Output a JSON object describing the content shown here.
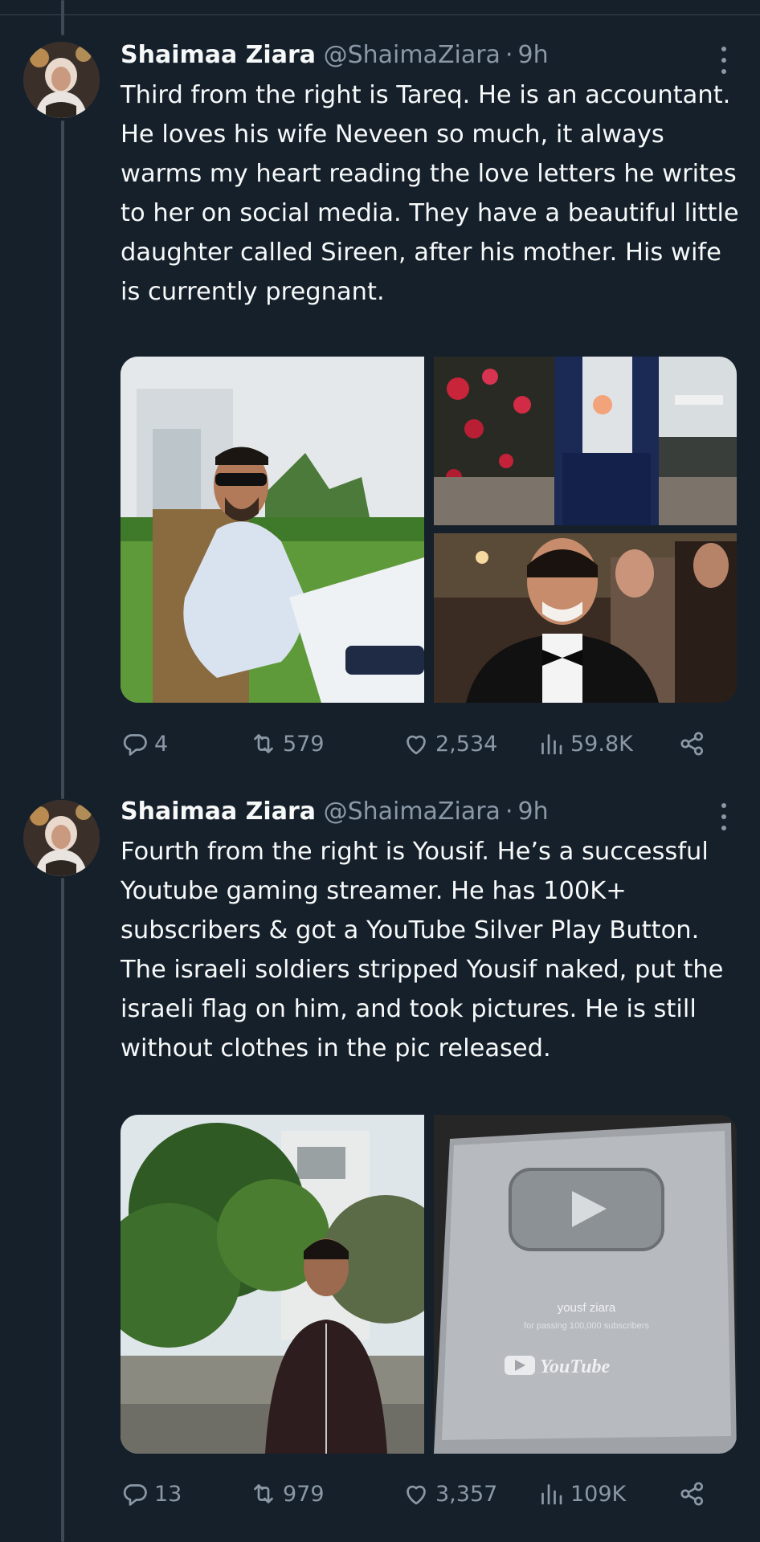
{
  "tweets": [
    {
      "name": "Shaimaa Ziara",
      "handle": "@ShaimaZiara",
      "separator": "·",
      "time": "9h",
      "text": "Third from the right is Tareq. He is an accountant. He loves his wife Neveen so much, it always warms my heart reading the love letters he writes to her on social media. They have a beautiful little daughter called Sireen, after his mother. His wife is currently pregnant.",
      "replies": "4",
      "retweets": "579",
      "likes": "2,534",
      "views": "59.8K"
    },
    {
      "name": "Shaimaa Ziara",
      "handle": "@ShaimaZiara",
      "separator": "·",
      "time": "9h",
      "text": "Fourth from the right is Yousif. He’s a successful Youtube gaming streamer. He has 100K+ subscribers & got a YouTube Silver Play Button. The israeli soldiers stripped Yousif naked, put the israeli flag on him, and took pictures. He is still without clothes in the pic released.",
      "replies": "13",
      "retweets": "979",
      "likes": "3,357",
      "views": "109K",
      "plaque": {
        "name": "yousf ziara",
        "caption": "for passing 100,000 subscribers",
        "brand": "YouTube"
      }
    }
  ],
  "colors": {
    "background": "#15202b",
    "text": "#f7f9f9",
    "muted": "#8b98a5",
    "thread_line": "#3d4a56"
  },
  "icons": [
    "more-icon",
    "reply-icon",
    "retweet-icon",
    "like-icon",
    "views-icon",
    "share-icon"
  ]
}
